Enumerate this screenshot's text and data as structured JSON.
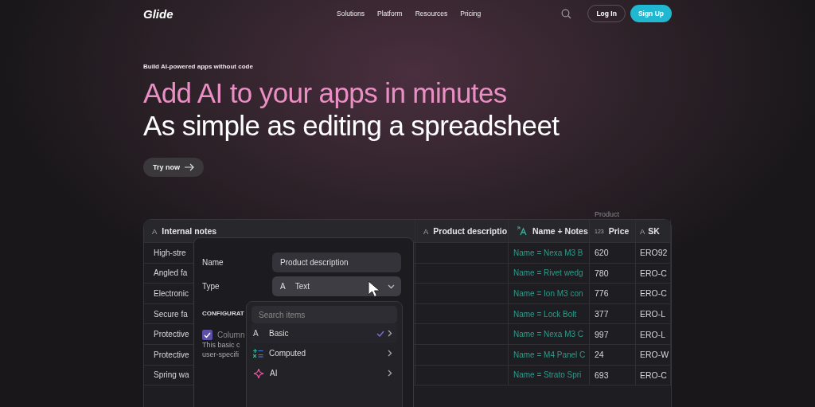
{
  "nav": {
    "logo": "Glide",
    "links": [
      "Solutions",
      "Platform",
      "Resources",
      "Pricing"
    ],
    "login": "Log In",
    "signup": "Sign Up"
  },
  "hero": {
    "eyebrow": "Build AI-powered apps without code",
    "headline": "Add AI to your apps in minutes",
    "subheadline": "As simple as editing a spreadsheet",
    "cta": "Try now"
  },
  "table": {
    "group_label": "Product",
    "columns": [
      {
        "label": "Internal notes",
        "glyph": "A"
      },
      {
        "label": "Product descriptio",
        "glyph": "A"
      },
      {
        "label": "Name + Notes",
        "kind": "computed"
      },
      {
        "label": "Price",
        "glyph": "123"
      },
      {
        "label": "SK",
        "glyph": "A"
      }
    ],
    "rows": [
      {
        "cells": [
          "High-stre",
          "",
          "Name = Nexa M3 B",
          "620",
          "ERO92"
        ]
      },
      {
        "cells": [
          "Angled fa",
          "",
          "Name = Rivet wedg",
          "780",
          "ERO-C"
        ]
      },
      {
        "cells": [
          "Electronic",
          "",
          "Name = Ion M3 con",
          "776",
          "ERO-C"
        ]
      },
      {
        "cells": [
          "Secure fa",
          "",
          "Name = Lock Bolt",
          "377",
          "ERO-L"
        ]
      },
      {
        "cells": [
          "Protective",
          "",
          "Name = Nexa M3 C",
          "997",
          "ERO-L"
        ]
      },
      {
        "cells": [
          "Protective",
          "",
          "Name = M4 Panel C",
          "24",
          "ERO-W"
        ]
      },
      {
        "cells": [
          "Spring wa",
          "",
          "Name = Strato Spri",
          "693",
          "ERO-C"
        ]
      }
    ]
  },
  "column_panel": {
    "name_label": "Name",
    "name_value": "Product description",
    "type_label": "Type",
    "type_glyph": "A",
    "type_value": "Text",
    "section_title": "CONFIGURAT",
    "option_label": "Column",
    "option_checked": true,
    "description_lines": [
      "This basic c",
      "user-specifi"
    ]
  },
  "type_menu": {
    "search_placeholder": "Search items",
    "items": [
      {
        "label": "Basic",
        "kind": "text",
        "glyph": "A",
        "selected": true
      },
      {
        "label": "Computed",
        "kind": "computed",
        "selected": false
      },
      {
        "label": "AI",
        "kind": "ai",
        "selected": false
      }
    ]
  }
}
